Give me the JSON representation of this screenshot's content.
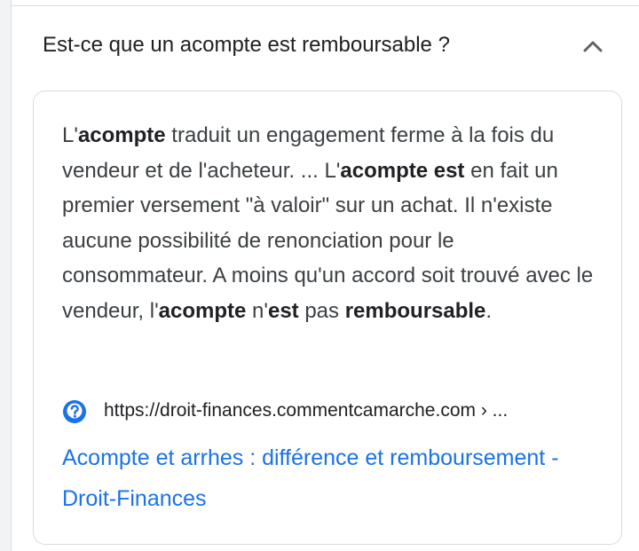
{
  "faq": {
    "question": "Est-ce que un acompte est remboursable ?",
    "expanded": true,
    "toggle_icon": "chevron-up-icon",
    "answer_segments": [
      {
        "text": "L'",
        "bold": false
      },
      {
        "text": "acompte",
        "bold": true
      },
      {
        "text": " traduit un engagement ferme à la fois du vendeur et de l'acheteur. ... L'",
        "bold": false
      },
      {
        "text": "acompte est",
        "bold": true
      },
      {
        "text": " en fait un premier versement \"à valoir\" sur un achat. Il n'existe aucune possibilité de renonciation pour le consommateur. A moins qu'un accord soit trouvé avec le vendeur, l'",
        "bold": false
      },
      {
        "text": "acompte",
        "bold": true
      },
      {
        "text": " n'",
        "bold": false
      },
      {
        "text": "est",
        "bold": true
      },
      {
        "text": " pas ",
        "bold": false
      },
      {
        "text": "remboursable",
        "bold": true
      },
      {
        "text": ".",
        "bold": false
      }
    ],
    "source": {
      "favicon": "question-mark-icon",
      "url": "https://droit-finances.commentcamarche.com › ...",
      "link_title": "Acompte et arrhes : différence et remboursement - Droit-Finances"
    }
  },
  "colors": {
    "link": "#1a73e8",
    "text": "#202124",
    "body_text": "#3c4043",
    "border": "#dadce0",
    "favicon": "#1a73e8"
  }
}
